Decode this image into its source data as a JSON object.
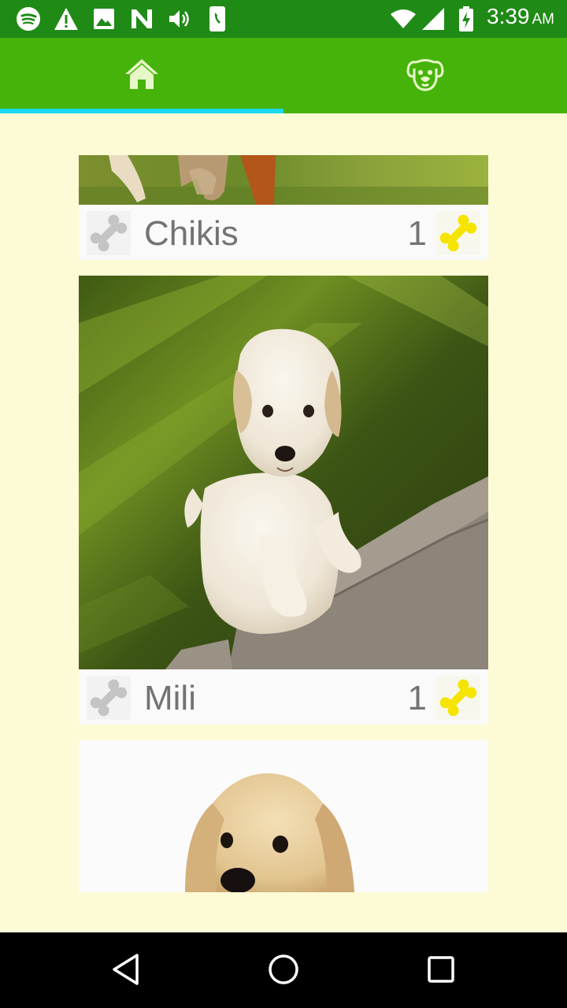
{
  "status_bar": {
    "time": "3:39",
    "ampm": "AM",
    "notification_icons": [
      "spotify-icon",
      "warning-icon",
      "image-icon",
      "n-app-icon",
      "volume-icon",
      "phone-call-icon"
    ],
    "system_icons": [
      "wifi-icon",
      "signal-icon",
      "battery-charging-icon"
    ]
  },
  "tabs": [
    {
      "icon": "home-icon",
      "selected": true
    },
    {
      "icon": "dog-face-icon",
      "selected": false
    }
  ],
  "pets": [
    {
      "name": "Chikis",
      "likes": "1",
      "photo": "dog-in-grass-photo"
    },
    {
      "name": "Mili",
      "likes": "1",
      "photo": "white-puppy-on-grass-photo"
    },
    {
      "name": "",
      "likes": "",
      "photo": "golden-puppy-photo"
    }
  ],
  "colors": {
    "status_bar": "#1f8a16",
    "tab_bar": "#46b30b",
    "tab_indicator": "#1ad9ee",
    "background": "#fdfbd6",
    "bone_like": "#f5e400",
    "bone_neutral": "#c4c4c4"
  },
  "nav_bar": {
    "buttons": [
      "back-icon",
      "home-circle-icon",
      "recents-icon"
    ]
  }
}
